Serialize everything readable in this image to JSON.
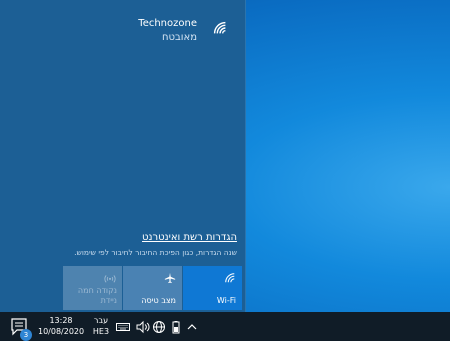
{
  "network": {
    "name": "Technozone",
    "status": "מאובטח",
    "icon": "wifi-icon"
  },
  "settings": {
    "link_label": "הגדרות רשת ואינטרנט",
    "description": "שנה הגדרות, כגון הפיכת החיבור לחיבור לפי שימוש."
  },
  "quick_actions": [
    {
      "label": "Wi-Fi",
      "icon": "wifi-icon",
      "state": "on"
    },
    {
      "label": "מצב טיסה",
      "icon": "airplane-icon",
      "state": "off"
    },
    {
      "label_line1": "נקודה חמה",
      "label_line2": "ניידת",
      "icon": "hotspot-icon",
      "state": "disabled"
    }
  ],
  "taskbar": {
    "notification_count": "3",
    "time": "13:28",
    "date": "10/08/2020",
    "language_line1": "עבר",
    "language_line2": "HE3"
  },
  "colors": {
    "flyout_bg": "#1c5f95",
    "wifi_tile_active": "#0f78d4",
    "taskbar_bg": "#101c27",
    "desktop_accent": "#1289dc"
  }
}
